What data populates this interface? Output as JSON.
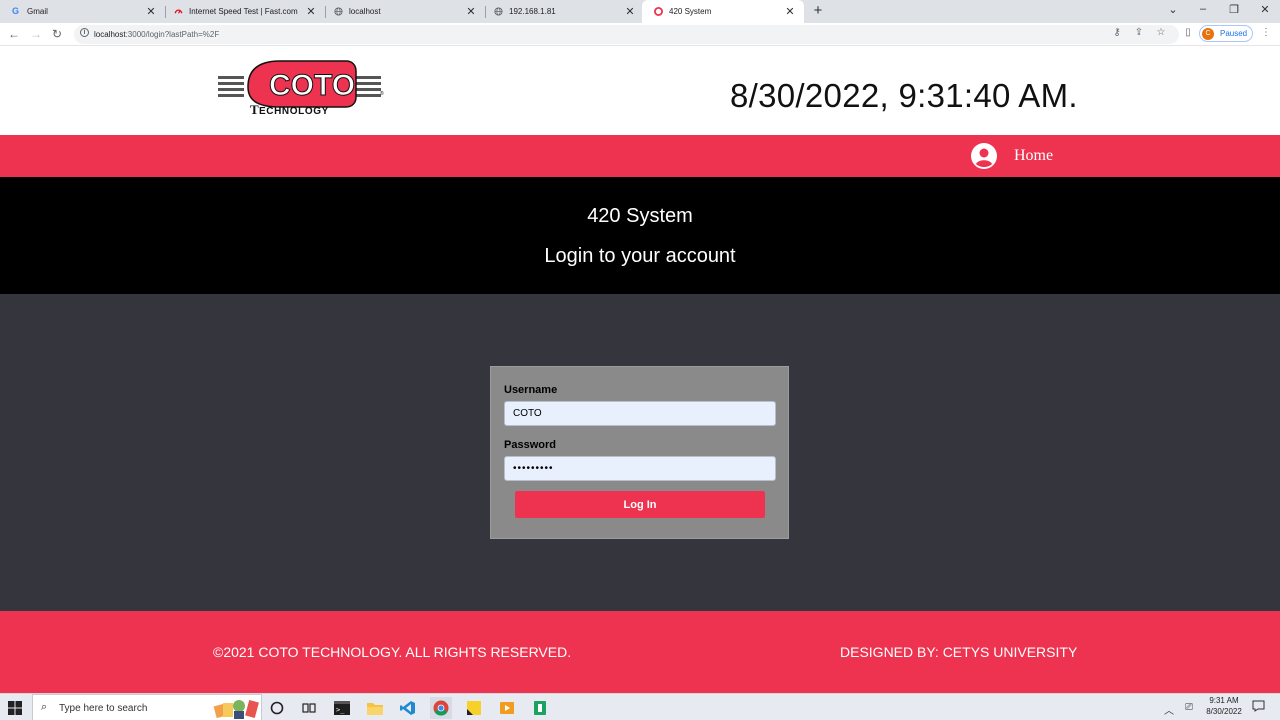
{
  "browser": {
    "tabs": [
      {
        "title": "Gmail",
        "icon": "gmail-icon"
      },
      {
        "title": "Internet Speed Test | Fast.com",
        "icon": "fastcom-icon"
      },
      {
        "title": "localhost",
        "icon": "globe-icon"
      },
      {
        "title": "192.168.1.81",
        "icon": "globe-icon"
      },
      {
        "title": "420 System",
        "icon": "coto-favicon",
        "active": true
      }
    ],
    "url_host": "localhost",
    "url_rest": ":3000/login?lastPath=%2F",
    "profile_initial": "C",
    "profile_status": "Paused"
  },
  "header": {
    "datetime": "8/30/2022, 9:31:40 AM."
  },
  "nav": {
    "home_label": "Home"
  },
  "hero": {
    "title": "420 System",
    "subtitle": "Login to your account"
  },
  "login": {
    "username_label": "Username",
    "username_value": "COTO",
    "password_label": "Password",
    "password_value": "•••••••••",
    "submit_label": "Log In"
  },
  "footer": {
    "copyright": "©2021 COTO TECHNOLOGY. ALL RIGHTS RESERVED.",
    "designed_by": "DESIGNED BY: CETYS UNIVERSITY"
  },
  "taskbar": {
    "search_placeholder": "Type here to search",
    "time": "9:31 AM",
    "date": "8/30/2022"
  },
  "colors": {
    "brand_red": "#ee3350",
    "content_bg": "#35353e",
    "card_bg": "#8a8a8a",
    "hero_bg": "#000000"
  }
}
